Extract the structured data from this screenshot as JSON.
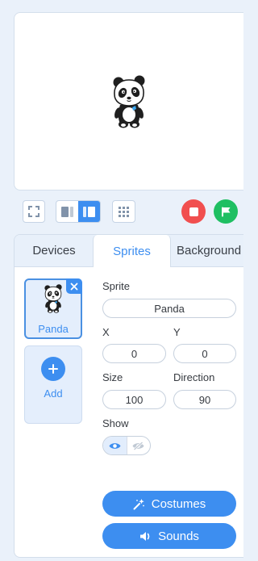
{
  "colors": {
    "accent": "#3d8ef0",
    "stop": "#f14f4f",
    "go": "#1fbf62",
    "page_background": "#eaf1fa"
  },
  "stage": {
    "sprite_icon": "panda-sprite"
  },
  "stage_toolbar": {
    "fullscreen_icon": "fullscreen-icon",
    "layout_buttons": [
      {
        "icon": "small-stage-icon",
        "active": false
      },
      {
        "icon": "large-stage-icon",
        "active": true
      }
    ],
    "grid_icon": "grid-icon",
    "stop_icon": "stop-icon",
    "go_icon": "green-flag-icon"
  },
  "tabs": [
    {
      "label": "Devices",
      "active": false
    },
    {
      "label": "Sprites",
      "active": true
    },
    {
      "label": "Background",
      "active": false
    }
  ],
  "sprite_list": {
    "items": [
      {
        "label": "Panda",
        "icon": "panda-sprite",
        "close_icon": "close-icon",
        "selected": true
      }
    ],
    "add": {
      "label": "Add",
      "icon": "plus-icon"
    }
  },
  "properties": {
    "sprite_label": "Sprite",
    "sprite_value": "Panda",
    "x_label": "X",
    "x_value": "0",
    "y_label": "Y",
    "y_value": "0",
    "size_label": "Size",
    "size_value": "100",
    "direction_label": "Direction",
    "direction_value": "90",
    "show_label": "Show",
    "show_options": [
      {
        "icon": "eye-icon",
        "active": true
      },
      {
        "icon": "eye-off-icon",
        "active": false
      }
    ]
  },
  "actions": {
    "costumes": {
      "label": "Costumes",
      "icon": "wand-icon"
    },
    "sounds": {
      "label": "Sounds",
      "icon": "speaker-icon"
    }
  }
}
